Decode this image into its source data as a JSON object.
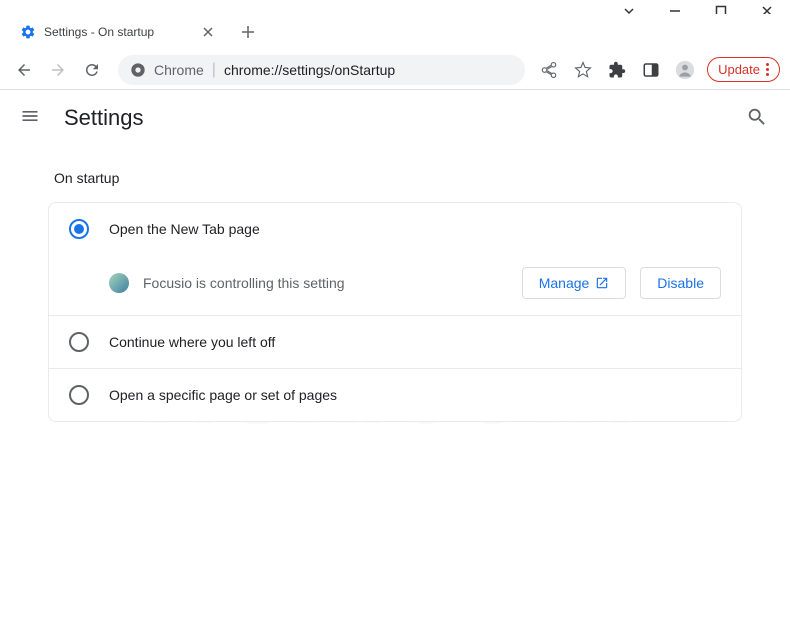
{
  "window": {
    "tab_title": "Settings - On startup"
  },
  "toolbar": {
    "url_host": "Chrome",
    "url_path": "chrome://settings/onStartup",
    "update_label": "Update"
  },
  "header": {
    "title": "Settings"
  },
  "content": {
    "section_title": "On startup",
    "options": [
      {
        "label": "Open the New Tab page",
        "selected": true
      },
      {
        "label": "Continue where you left off",
        "selected": false
      },
      {
        "label": "Open a specific page or set of pages",
        "selected": false
      }
    ],
    "extension": {
      "message": "Focusio is controlling this setting",
      "manage_label": "Manage",
      "disable_label": "Disable"
    }
  },
  "watermark": "PC\nrisk.com"
}
